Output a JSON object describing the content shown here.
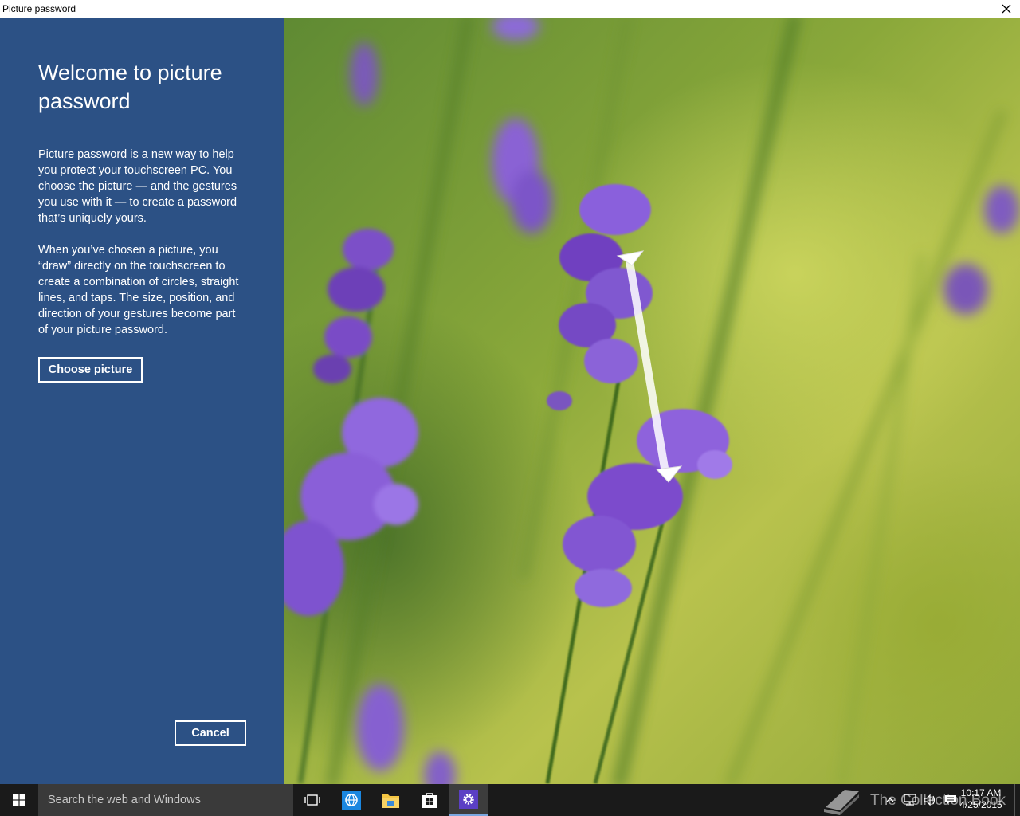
{
  "window": {
    "title": "Picture password"
  },
  "panel": {
    "heading": "Welcome to picture password",
    "paragraph1": "Picture password is a new way to help you protect your touchscreen PC. You choose the picture — and the gestures you use with it — to create a password that’s uniquely yours.",
    "paragraph2": "When you’ve chosen a picture, you “draw” directly on the touchscreen to create a combination of circles, straight lines, and taps. The size, position, and direction of your gestures become part of your picture password.",
    "choose_label": "Choose picture",
    "cancel_label": "Cancel",
    "background_color": "#2c5185"
  },
  "photo": {
    "subject": "lavender flowers",
    "gesture": "straight-line"
  },
  "taskbar": {
    "search_placeholder": "Search the web and Windows",
    "watermark": "The Collection Book",
    "time": "10:17 AM",
    "date": "4/25/2015",
    "icons": [
      "windows-start-icon",
      "task-view-icon",
      "ie-icon",
      "file-explorer-icon",
      "store-icon",
      "settings-icon"
    ],
    "tray_icons": [
      "tray-chevron-icon",
      "network-icon",
      "volume-icon",
      "action-center-icon"
    ]
  }
}
